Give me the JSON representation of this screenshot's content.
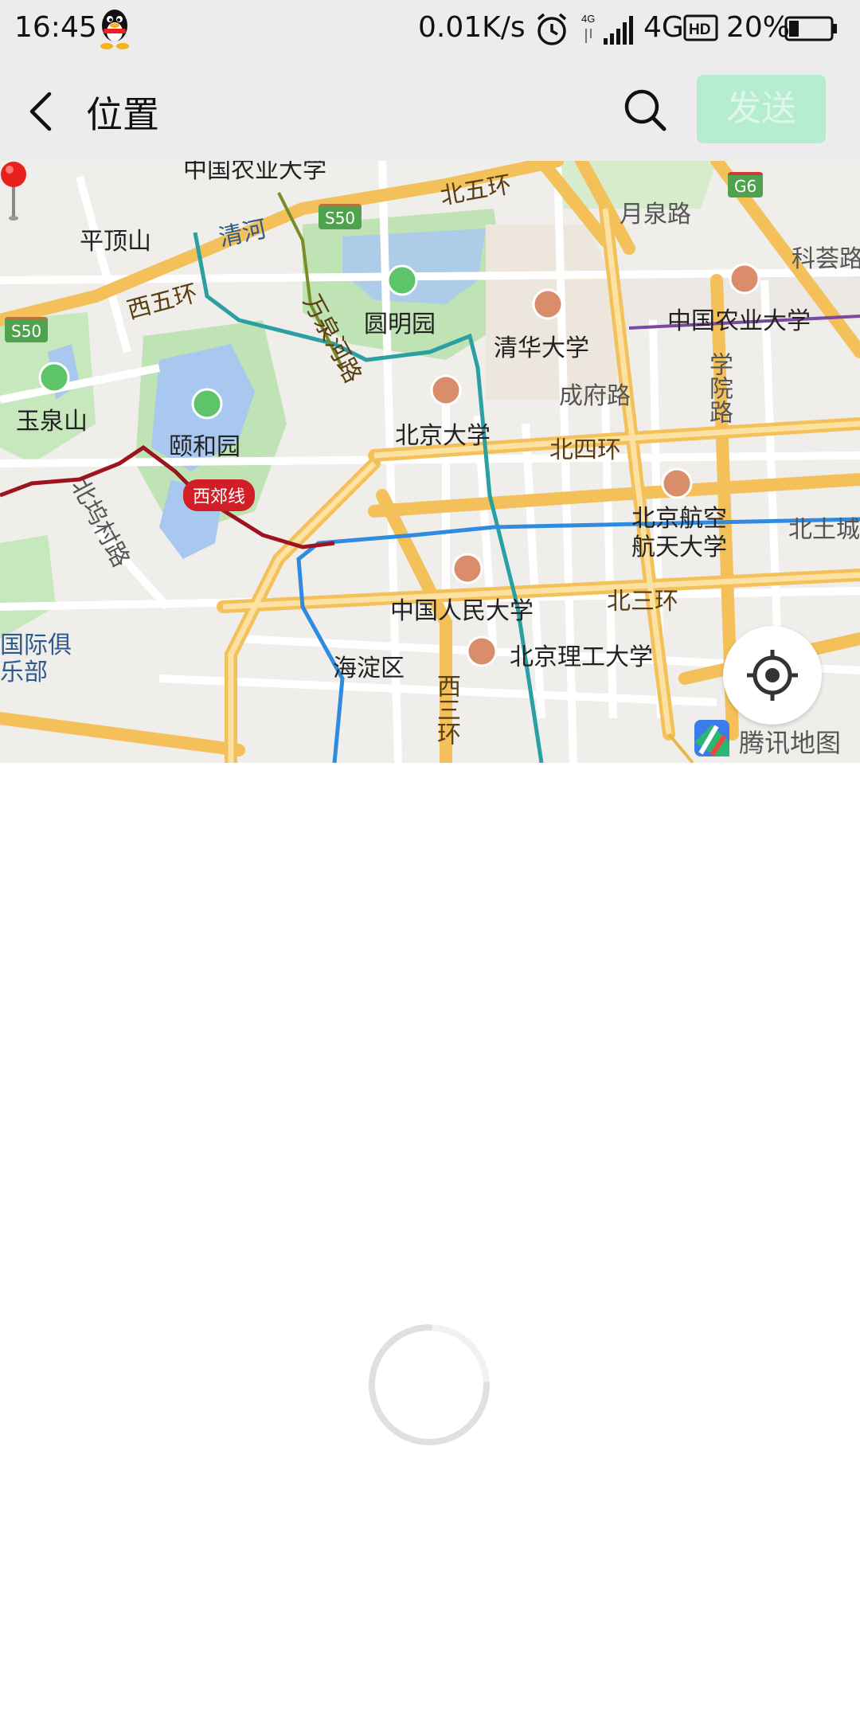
{
  "status_bar": {
    "time": "16:45",
    "network_speed": "0.01K/s",
    "network_type": "4G",
    "battery_percent": "20%"
  },
  "title_bar": {
    "title": "位置",
    "send_label": "发送"
  },
  "map": {
    "labels": {
      "top_edge": "中国农业大学",
      "pingdingshan": "平顶山",
      "qinghe": "清河",
      "beiwuhuan": "北五环",
      "yuequanlu": "月泉路",
      "kehuilu": "科荟路",
      "xiwuhuan": "西五环",
      "wanquanhelu": "万泉河路",
      "yuanmingyuan": "圆明园",
      "tsinghua": "清华大学",
      "cau": "中国农业大学",
      "yuquanshan": "玉泉山",
      "yiheyuan": "颐和园",
      "chengfulu": "成府路",
      "xueyuanlu": "学院路",
      "pku": "北京大学",
      "beisihuan": "北四环",
      "buaa": "北京航空航天大学",
      "beitucheng": "北土城",
      "beiwucunlu": "北坞村路",
      "ruc": "中国人民大学",
      "beisanhuan": "北三环",
      "guoji": "国际俱乐部",
      "haidianqu": "海淀区",
      "bit": "北京理工大学",
      "xisanhuan": "西三环"
    },
    "shields": {
      "s50_top": "S50",
      "s50_left": "S50",
      "g6": "G6"
    },
    "metro_line": "西郊线",
    "brand": "腾讯地图"
  },
  "colors": {
    "send_bg": "#b6edd0",
    "pin": "#e8201c",
    "water": "#a8c8f0",
    "park": "#bfe3b4",
    "road_major": "#f8d27a"
  }
}
